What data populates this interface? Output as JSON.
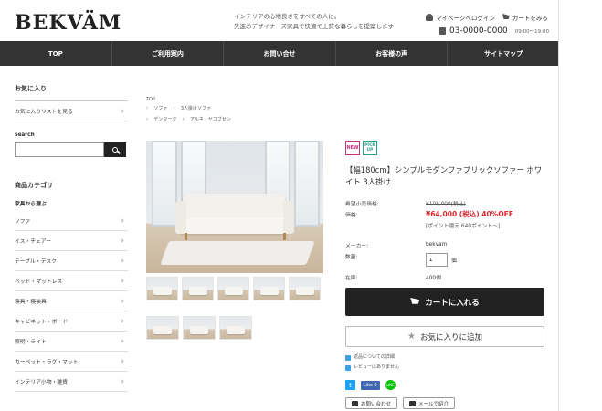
{
  "header": {
    "logo": "BEKVÄM",
    "tagline1": "インテリアの心地良さをすべての人に。",
    "tagline2": "先進のデザイナーズ家具で快適で上質な暮らしを提案します",
    "mypage": "マイページへログイン",
    "cart": "カートをみる",
    "phone": "03-0000-0000",
    "hours": "09:00～19:00"
  },
  "nav": [
    "TOP",
    "ご利用案内",
    "お問い合せ",
    "お客様の声",
    "サイトマップ"
  ],
  "sidebar": {
    "fav_title": "お気に入り",
    "fav_link": "お気に入りリストを見る",
    "search_label": "search",
    "search_value": "",
    "cat_title": "商品カテゴリ",
    "cat_sub": "家具から選ぶ",
    "items": [
      "ソファ",
      "イス・チェアー",
      "テーブル・デスク",
      "ベッド・マットレス",
      "寝具・寝装具",
      "キャビネット・ボード",
      "照明・ライト",
      "カーペット・ラグ・マット",
      "インテリア小物・雑貨"
    ]
  },
  "breadcrumb": {
    "top": "TOP",
    "l1a": "ソファ",
    "l1b": "3人掛けソファ",
    "l2a": "デンマーク",
    "l2b": "アルネ・ヤコブセン"
  },
  "product": {
    "badge_new": "NEW",
    "badge_pick": "PICK UP",
    "name": "【幅180cm】シンプルモダンファブリックソファー ホワイト 3人掛け",
    "list_price_label": "希望小売価格:",
    "list_price": "¥108,000(税込)",
    "price_label": "価格:",
    "price": "¥64,000 (税込) 40%OFF",
    "points": "[ポイント還元 640ポイント～]",
    "maker_label": "メーカー:",
    "maker": "bekvam",
    "qty_label": "数量:",
    "qty": "1",
    "qty_unit": "個",
    "stock_label": "在庫:",
    "stock": "400個",
    "add_cart": "カートに入れる",
    "add_fav": "お気に入りに追加",
    "link_return": "返品についての詳細",
    "link_review": "レビューはありません",
    "fb_like": "Like 0",
    "line": "LINE",
    "contact": "お問い合わせ",
    "mail": "メールで紹介"
  }
}
